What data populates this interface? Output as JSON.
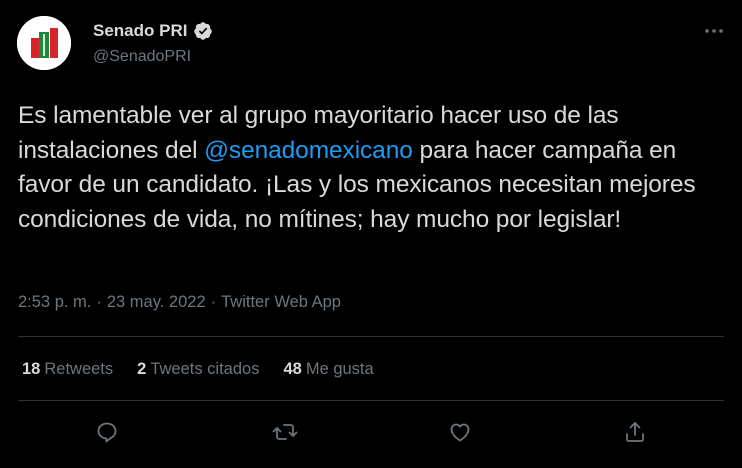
{
  "colors": {
    "background": "#000000",
    "text": "#d9d9d9",
    "secondary": "#6e767d",
    "link": "#1d9bf0",
    "divider": "#2f3336"
  },
  "author": {
    "display_name": "Senado PRI",
    "handle": "@SenadoPRI",
    "verified_icon": "verified-badge-icon",
    "avatar_icon": "pri-logo"
  },
  "tweet": {
    "text_before": "Es lamentable ver al grupo mayoritario hacer uso de las instalaciones del ",
    "mention": "@senadomexicano",
    "text_after": " para hacer campaña en favor de un candidato. ¡Las y los mexicanos necesitan mejores condiciones de vida, no mítines; hay mucho por legislar!"
  },
  "meta": {
    "time": "2:53 p. m.",
    "separator1": "·",
    "date": "23 may. 2022",
    "separator2": "·",
    "source": "Twitter Web App"
  },
  "stats": {
    "retweets_count": "18",
    "retweets_label": "Retweets",
    "quotes_count": "2",
    "quotes_label": "Tweets citados",
    "likes_count": "48",
    "likes_label": "Me gusta"
  },
  "actions": {
    "reply_icon": "reply-icon",
    "retweet_icon": "retweet-icon",
    "like_icon": "heart-icon",
    "share_icon": "share-icon",
    "more_icon": "more-icon"
  }
}
